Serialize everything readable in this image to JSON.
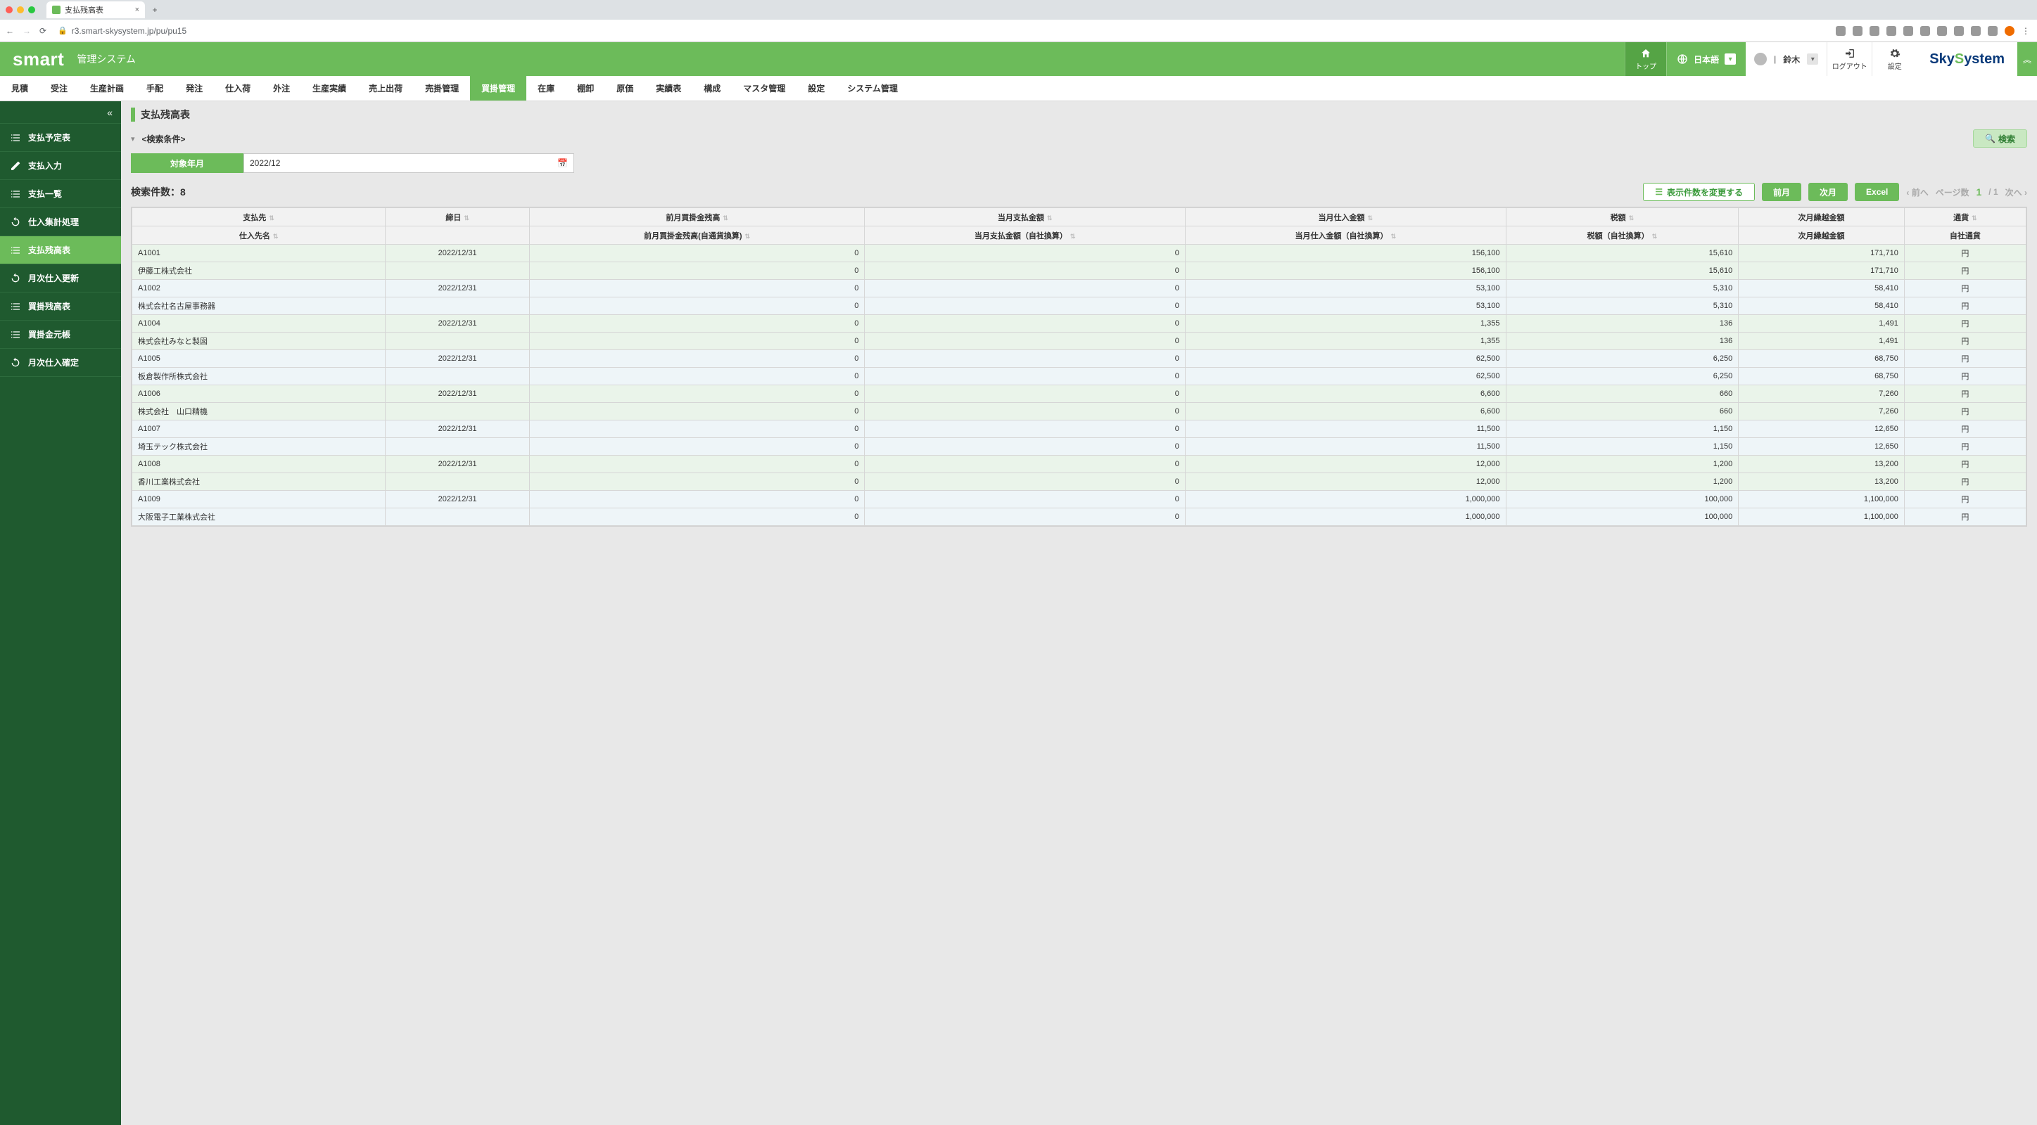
{
  "browser": {
    "tab_title": "支払残高表",
    "url": "r3.smart-skysystem.jp/pu/pu15"
  },
  "header": {
    "logo": "smart",
    "subtitle": "管理システム",
    "top_label": "トップ",
    "language": "日本語",
    "user_name": "鈴木",
    "logout": "ログアウト",
    "settings": "設定",
    "company_logo": {
      "part1": "Sky",
      "part2": "S",
      "part3": "ystem"
    }
  },
  "topnav": {
    "items": [
      "見積",
      "受注",
      "生産計画",
      "手配",
      "発注",
      "仕入荷",
      "外注",
      "生産実績",
      "売上出荷",
      "売掛管理",
      "買掛管理",
      "在庫",
      "棚卸",
      "原価",
      "実績表",
      "構成",
      "マスタ管理",
      "設定",
      "システム管理"
    ],
    "active_index": 10
  },
  "sidebar": {
    "items": [
      {
        "label": "支払予定表",
        "icon": "list"
      },
      {
        "label": "支払入力",
        "icon": "edit"
      },
      {
        "label": "支払一覧",
        "icon": "list"
      },
      {
        "label": "仕入集計処理",
        "icon": "refresh"
      },
      {
        "label": "支払残高表",
        "icon": "list"
      },
      {
        "label": "月次仕入更新",
        "icon": "refresh"
      },
      {
        "label": "買掛残高表",
        "icon": "list"
      },
      {
        "label": "買掛金元帳",
        "icon": "list"
      },
      {
        "label": "月次仕入確定",
        "icon": "refresh"
      }
    ],
    "active_index": 4
  },
  "page": {
    "title": "支払残高表",
    "search_cond_label": "<検索条件>",
    "target_period_label": "対象年月",
    "target_period_value": "2022/12",
    "search_button": "検索",
    "result_count_label": "検索件数：",
    "result_count": "8",
    "change_display_count": "表示件数を変更する",
    "prev_month": "前月",
    "next_month": "次月",
    "excel": "Excel",
    "pager_prev": "前へ",
    "pager_next": "次へ",
    "pager_label": "ページ数",
    "pager_current": "1",
    "pager_total": "/ 1"
  },
  "table": {
    "headers_row1": [
      "支払先",
      "締日",
      "前月買掛金残高",
      "当月支払金額",
      "当月仕入金額",
      "税額",
      "次月繰越金額",
      "通貨"
    ],
    "headers_row2": [
      "仕入先名",
      "",
      "前月買掛金残高(自通貨換算)",
      "当月支払金額（自社換算）",
      "当月仕入金額（自社換算）",
      "税額（自社換算）",
      "次月繰越金額",
      "自社通貨"
    ],
    "rows": [
      {
        "code": "A1001",
        "date": "2022/12/31",
        "c3": "0",
        "c4": "0",
        "c5": "156,100",
        "c6": "15,610",
        "c7": "171,710",
        "cur": "円",
        "name": "伊藤工株式会社",
        "c3b": "0",
        "c4b": "0",
        "c5b": "156,100",
        "c6b": "15,610",
        "c7b": "171,710",
        "curb": "円",
        "cls": "even"
      },
      {
        "code": "A1002",
        "date": "2022/12/31",
        "c3": "0",
        "c4": "0",
        "c5": "53,100",
        "c6": "5,310",
        "c7": "58,410",
        "cur": "円",
        "name": "株式会社名古屋事務器",
        "c3b": "0",
        "c4b": "0",
        "c5b": "53,100",
        "c6b": "5,310",
        "c7b": "58,410",
        "curb": "円",
        "cls": "odd"
      },
      {
        "code": "A1004",
        "date": "2022/12/31",
        "c3": "0",
        "c4": "0",
        "c5": "1,355",
        "c6": "136",
        "c7": "1,491",
        "cur": "円",
        "name": "株式会社みなと製図",
        "c3b": "0",
        "c4b": "0",
        "c5b": "1,355",
        "c6b": "136",
        "c7b": "1,491",
        "curb": "円",
        "cls": "even"
      },
      {
        "code": "A1005",
        "date": "2022/12/31",
        "c3": "0",
        "c4": "0",
        "c5": "62,500",
        "c6": "6,250",
        "c7": "68,750",
        "cur": "円",
        "name": "板倉製作所株式会社",
        "c3b": "0",
        "c4b": "0",
        "c5b": "62,500",
        "c6b": "6,250",
        "c7b": "68,750",
        "curb": "円",
        "cls": "odd"
      },
      {
        "code": "A1006",
        "date": "2022/12/31",
        "c3": "0",
        "c4": "0",
        "c5": "6,600",
        "c6": "660",
        "c7": "7,260",
        "cur": "円",
        "name": "株式会社　山口精機",
        "c3b": "0",
        "c4b": "0",
        "c5b": "6,600",
        "c6b": "660",
        "c7b": "7,260",
        "curb": "円",
        "cls": "even"
      },
      {
        "code": "A1007",
        "date": "2022/12/31",
        "c3": "0",
        "c4": "0",
        "c5": "11,500",
        "c6": "1,150",
        "c7": "12,650",
        "cur": "円",
        "name": "埼玉テック株式会社",
        "c3b": "0",
        "c4b": "0",
        "c5b": "11,500",
        "c6b": "1,150",
        "c7b": "12,650",
        "curb": "円",
        "cls": "odd"
      },
      {
        "code": "A1008",
        "date": "2022/12/31",
        "c3": "0",
        "c4": "0",
        "c5": "12,000",
        "c6": "1,200",
        "c7": "13,200",
        "cur": "円",
        "name": "香川工業株式会社",
        "c3b": "0",
        "c4b": "0",
        "c5b": "12,000",
        "c6b": "1,200",
        "c7b": "13,200",
        "curb": "円",
        "cls": "even"
      },
      {
        "code": "A1009",
        "date": "2022/12/31",
        "c3": "0",
        "c4": "0",
        "c5": "1,000,000",
        "c6": "100,000",
        "c7": "1,100,000",
        "cur": "円",
        "name": "大阪電子工業株式会社",
        "c3b": "0",
        "c4b": "0",
        "c5b": "1,000,000",
        "c6b": "100,000",
        "c7b": "1,100,000",
        "curb": "円",
        "cls": "odd"
      }
    ]
  }
}
